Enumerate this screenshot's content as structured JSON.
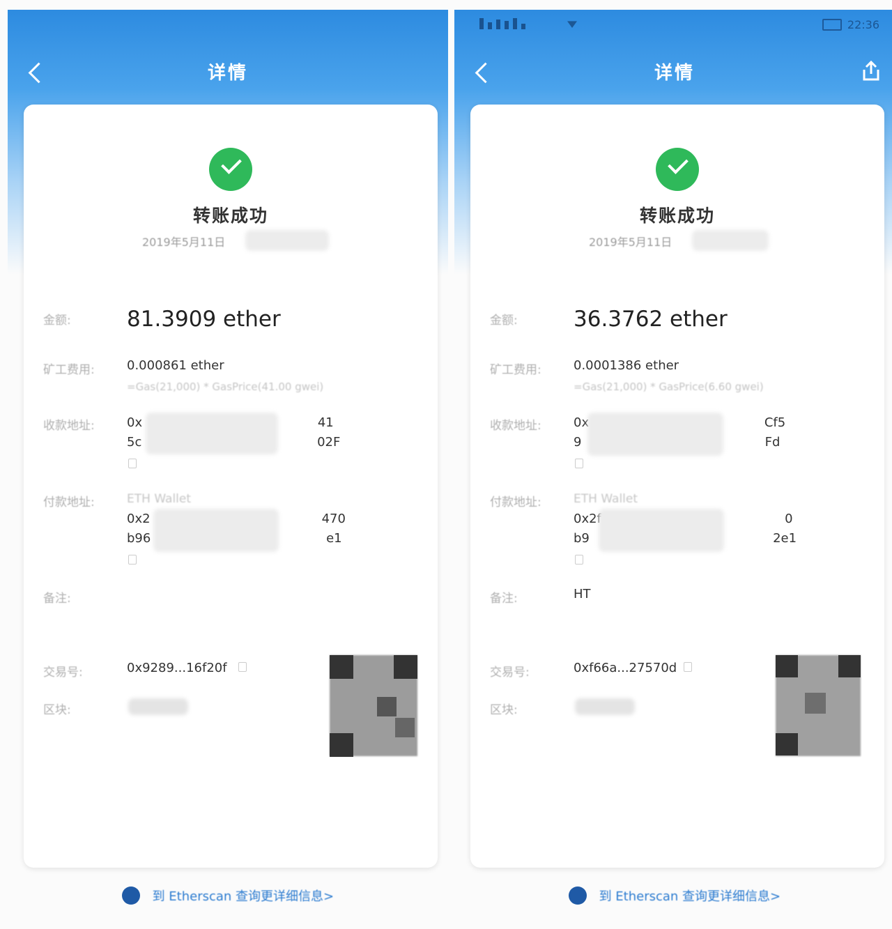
{
  "status_bar": {
    "time": "22:36"
  },
  "panels": [
    {
      "nav": {
        "title": "详情"
      },
      "status": {
        "title": "转账成功",
        "date": "2019年5月11日"
      },
      "fields": {
        "amount_label": "金额:",
        "amount_value": "81.3909 ether",
        "fee_label": "矿工费用:",
        "fee_value": "0.000861 ether",
        "fee_formula": "=Gas(21,000) * GasPrice(41.00 gwei)",
        "recipient_label": "收款地址:",
        "recipient_line1": "0x                                            41",
        "recipient_line2": "5c                                            02F",
        "sender_label": "付款地址:",
        "sender_wallet": "ETH Wallet",
        "sender_line1": "0x2                                           470",
        "sender_line2": "b96                                            e1",
        "note_label": "备注:",
        "note_value": "",
        "txid_label": "交易号:",
        "txid_value": "0x9289...16f20f",
        "block_label": "区块:"
      },
      "footer": {
        "etherscan_text": "到 Etherscan 查询更详细信息>"
      }
    },
    {
      "nav": {
        "title": "详情"
      },
      "status": {
        "title": "转账成功",
        "date": "2019年5月11日"
      },
      "fields": {
        "amount_label": "金额:",
        "amount_value": "36.3762 ether",
        "fee_label": "矿工费用:",
        "fee_value": "0.0001386 ether",
        "fee_formula": "=Gas(21,000) * GasPrice(6.60 gwei)",
        "recipient_label": "收款地址:",
        "recipient_line1": "0x                                            Cf5",
        "recipient_line2": "9                                              Fd",
        "sender_label": "付款地址:",
        "sender_wallet": "ETH Wallet",
        "sender_line1": "0x2f                                              0",
        "sender_line2": "b9                                              2e1",
        "note_label": "备注:",
        "note_value": "HT",
        "txid_label": "交易号:",
        "txid_value": "0xf66a...27570d",
        "block_label": "区块:"
      },
      "footer": {
        "etherscan_text": "到 Etherscan 查询更详细信息>"
      }
    }
  ],
  "colors": {
    "header_blue": "#2d8be0",
    "success_green": "#2fb95a",
    "link_blue": "#2d7cd0"
  },
  "icons": [
    "back-icon",
    "share-icon",
    "check-icon",
    "copy-icon",
    "etherscan-logo-icon",
    "qr-code"
  ]
}
